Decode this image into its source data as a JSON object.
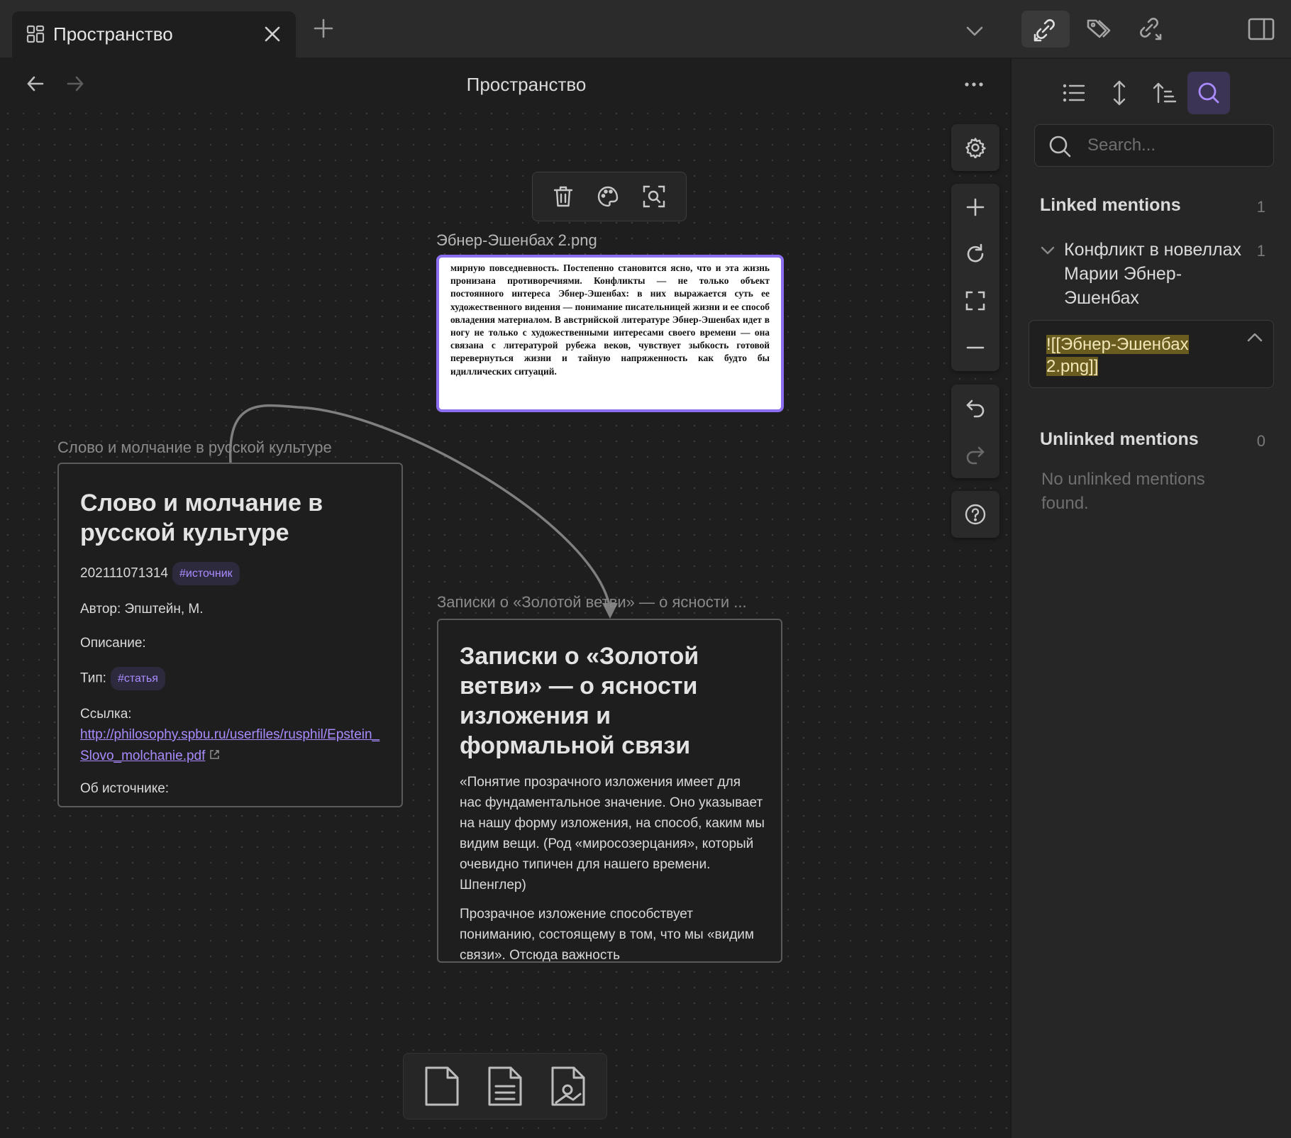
{
  "tab": {
    "title": "Пространство"
  },
  "header": {
    "title": "Пространство"
  },
  "toolbar": {
    "delete": "delete",
    "color": "color",
    "zoom_to_selection": "zoom"
  },
  "image_node": {
    "label": "Эбнер-Эшенбах 2.png",
    "scan_text": "мирную повседневность. Постепенно становится ясно, что и эта жизнь пронизана противоречиями. Конфликты — не только объект постоянного интереса Эбнер-Эшенбах: в них выражается суть ее художественного видения — понимание писательницей жизни и ее способ овладения материалом. В австрийской литературе Эбнер-Эшенбах идет в ногу не только с художественными интересами своего времени — она связана с литературой рубежа веков, чувствует зыбкость готовой перевернуться жизни и тайную напряженность как будто бы идиллических ситуаций."
  },
  "card1": {
    "label": "Слово и молчание в русской культуре",
    "title": "Слово и молчание в русской культуре",
    "id": "202111071314",
    "id_tag": "#источник",
    "author": "Автор: Эпштейн, М.",
    "description": "Описание:",
    "type_label": "Тип:",
    "type_tag": "#статья",
    "link_label": "Ссылка:",
    "link": "http://philosophy.spbu.ru/userfiles/rusphil/Epstein_Slovo_molchanie.pdf",
    "about": "Об источнике:"
  },
  "card2": {
    "label": "Записки о «Золотой ветви» — о ясности ...",
    "title": "Записки о «Золотой ветви» — о ясности изложения и формальной связи",
    "para1": "«Понятие прозрачного изложения имеет для нас фундаментальное значение. Оно указывает на нашу форму изложения, на способ, каким мы видим вещи. (Род «миросозерцания», который очевидно типичен для нашего времени. Шпенглер)",
    "para2": "Прозрачное изложение способствует пониманию, состоящему в том, что мы «видим связи». Отсюда важность"
  },
  "sidebar": {
    "search_placeholder": "Search...",
    "linked_heading": "Linked mentions",
    "linked_count": "1",
    "file_name": "Конфликт в новеллах Марии Эбнер-Эшенбах",
    "file_count": "1",
    "snippet": "![[Эбнер-Эшенбах 2.png]]",
    "unlinked_heading": "Unlinked mentions",
    "unlinked_count": "0",
    "unlinked_empty": "No unlinked mentions found."
  },
  "colors": {
    "accent": "#8b6ff0",
    "tag": "#a98bff",
    "highlight": "#6a5c1e"
  }
}
